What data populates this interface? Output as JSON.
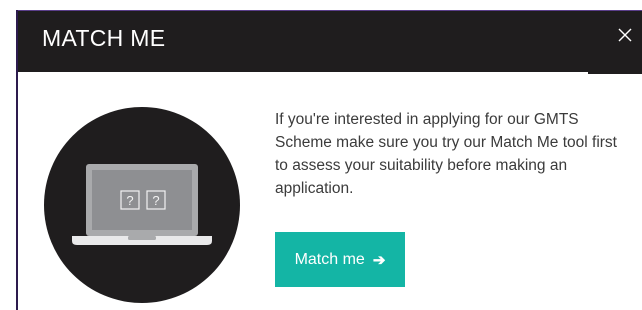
{
  "modal": {
    "title": "MATCH ME",
    "close_icon": "close-icon",
    "illustration_icon": "laptop-question-icon",
    "body_text": "If you're interested in applying for our GMTS Scheme make sure you try our Match Me tool first to assess your suitability before making an application.",
    "cta_label": "Match me",
    "cta_icon": "arrow-right-icon",
    "cta_arrow_glyph": "➔"
  },
  "colors": {
    "header_bg": "#1f1d1e",
    "accent": "#14b5a5",
    "text": "#3b3b3b",
    "border": "#2d1b4e"
  }
}
